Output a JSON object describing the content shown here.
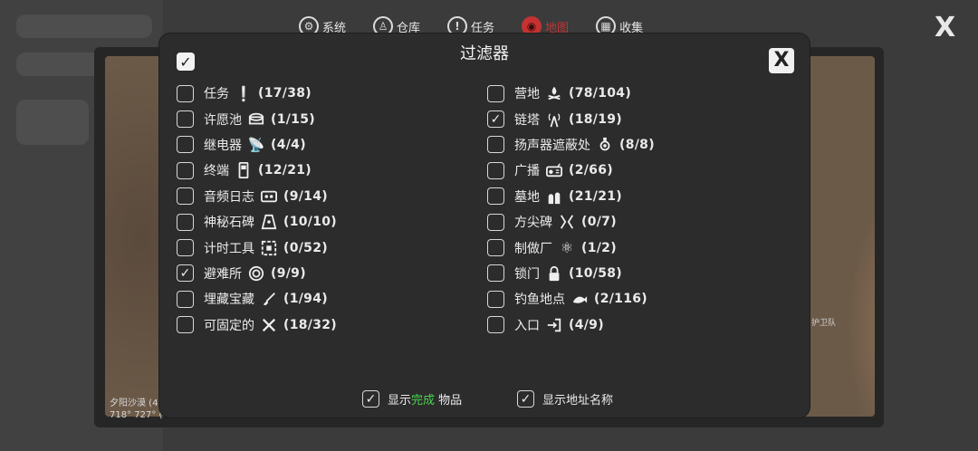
{
  "nav": {
    "items": [
      {
        "label": "系统",
        "icon": "system-icon",
        "active": false
      },
      {
        "label": "仓库",
        "icon": "inventory-icon",
        "active": false
      },
      {
        "label": "任务",
        "icon": "quest-icon",
        "active": false
      },
      {
        "label": "地图",
        "icon": "map-icon",
        "active": true
      },
      {
        "label": "收集",
        "icon": "collection-icon",
        "active": false
      }
    ],
    "close_label": "X"
  },
  "map": {
    "coords_line1": "夕阳沙漠 (4",
    "coords_line2": "718° 727° (",
    "right_label": "护卫队"
  },
  "dialog": {
    "title": "过滤器",
    "close_label": "X",
    "select_all_checked": true,
    "left_items": [
      {
        "label": "任务",
        "icon": "exclamation-icon",
        "count": "(17/38)",
        "checked": false
      },
      {
        "label": "许愿池",
        "icon": "wishing-well-icon",
        "count": "(1/15)",
        "checked": false
      },
      {
        "label": "继电器",
        "icon": "satellite-dish-icon",
        "count": "(4/4)",
        "checked": false
      },
      {
        "label": "终端",
        "icon": "terminal-icon",
        "count": "(12/21)",
        "checked": false
      },
      {
        "label": "音频日志",
        "icon": "cassette-icon",
        "count": "(9/14)",
        "checked": false
      },
      {
        "label": "神秘石碑",
        "icon": "stone-tablet-icon",
        "count": "(10/10)",
        "checked": false
      },
      {
        "label": "计时工具",
        "icon": "timer-tool-icon",
        "count": "(0/52)",
        "checked": false
      },
      {
        "label": "避难所",
        "icon": "shelter-icon",
        "count": "(9/9)",
        "checked": true
      },
      {
        "label": "埋藏宝藏",
        "icon": "shovel-icon",
        "count": "(1/94)",
        "checked": false
      },
      {
        "label": "可固定的",
        "icon": "crossed-tools-icon",
        "count": "(18/32)",
        "checked": false
      }
    ],
    "right_items": [
      {
        "label": "营地",
        "icon": "campfire-icon",
        "count": "(78/104)",
        "checked": false
      },
      {
        "label": "链塔",
        "icon": "radio-tower-icon",
        "count": "(18/19)",
        "checked": true
      },
      {
        "label": "扬声器遮蔽处",
        "icon": "speaker-shelter-icon",
        "count": "(8/8)",
        "checked": false
      },
      {
        "label": "广播",
        "icon": "radio-icon",
        "count": "(2/66)",
        "checked": false
      },
      {
        "label": "墓地",
        "icon": "graveyard-icon",
        "count": "(21/21)",
        "checked": false
      },
      {
        "label": "方尖碑",
        "icon": "obelisk-icon",
        "count": "(0/7)",
        "checked": false
      },
      {
        "label": "制做厂",
        "icon": "atom-icon",
        "count": "(1/2)",
        "checked": false
      },
      {
        "label": "锁门",
        "icon": "lock-icon",
        "count": "(10/58)",
        "checked": false
      },
      {
        "label": "钓鱼地点",
        "icon": "fish-icon",
        "count": "(2/116)",
        "checked": false
      },
      {
        "label": "入口",
        "icon": "entrance-icon",
        "count": "(4/9)",
        "checked": false
      }
    ],
    "show_completed": {
      "prefix": "显示",
      "highlight": "完成",
      "suffix": " 物品",
      "checked": true
    },
    "show_names": {
      "label": "显示地址名称",
      "checked": true
    }
  },
  "colors": {
    "accent_red": "#c43232",
    "highlight_green": "#45d64b",
    "dialog_bg": "#2c2c2c"
  }
}
